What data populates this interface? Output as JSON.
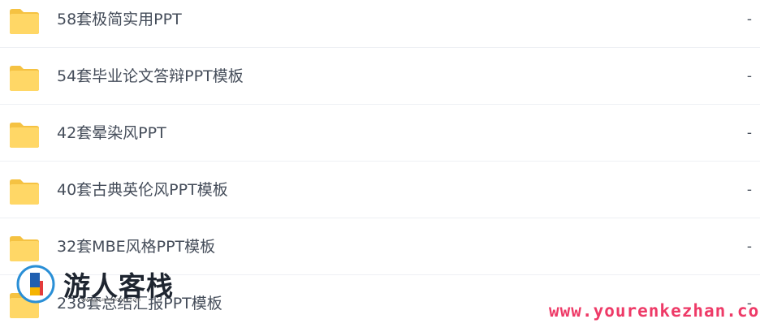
{
  "files": [
    {
      "name": "58套极简实用PPT",
      "size": "-"
    },
    {
      "name": "54套毕业论文答辩PPT模板",
      "size": "-"
    },
    {
      "name": "42套晕染风PPT",
      "size": "-"
    },
    {
      "name": "40套古典英伦风PPT模板",
      "size": "-"
    },
    {
      "name": "32套MBE风格PPT模板",
      "size": "-"
    },
    {
      "name": "238套总结汇报PPT模板",
      "size": "-"
    }
  ],
  "icons": {
    "folder": "folder-icon"
  },
  "colors": {
    "folder": "#ffd766",
    "folder_back": "#f5c242",
    "text": "#454d5a",
    "watermark_url": "#ee3a67"
  },
  "watermark": {
    "title": "游人客栈",
    "tiny": "www.yourenkezhan.com",
    "url": "www.yourenkezhan.com"
  }
}
